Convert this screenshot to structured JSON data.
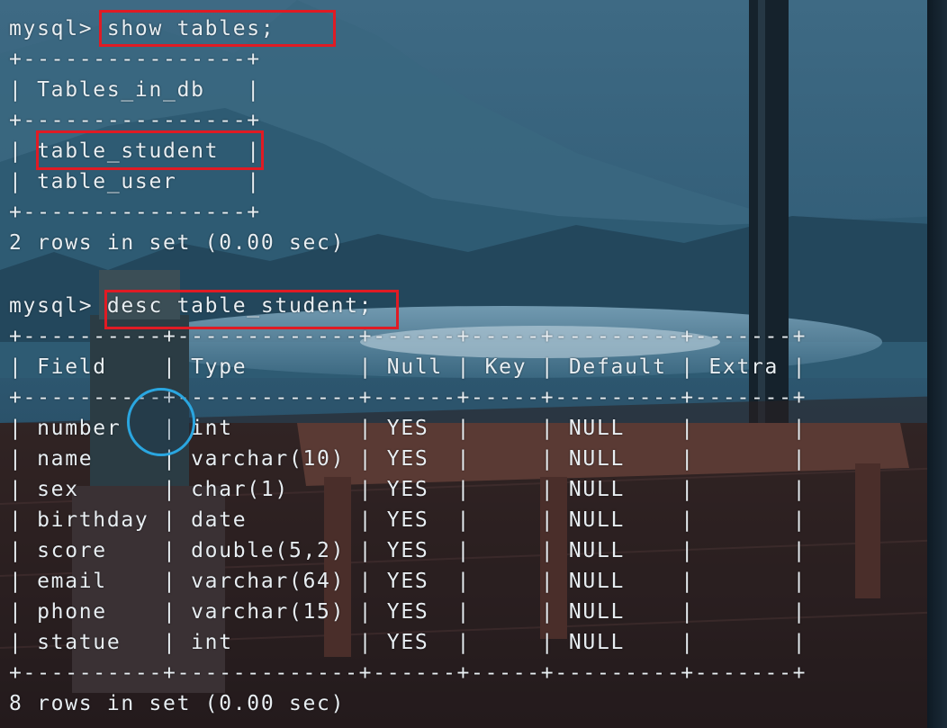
{
  "terminal": {
    "lines": [
      "mysql> show tables;",
      "+----------------+",
      "| Tables_in_db   |",
      "+----------------+",
      "| table_student  |",
      "| table_user     |",
      "+----------------+",
      "2 rows in set (0.00 sec)",
      "",
      "mysql> desc table_student;",
      "+----------+-------------+------+-----+---------+-------+",
      "| Field    | Type        | Null | Key | Default | Extra |",
      "+----------+-------------+------+-----+---------+-------+",
      "| number   | int         | YES  |     | NULL    |       |",
      "| name     | varchar(10) | YES  |     | NULL    |       |",
      "| sex      | char(1)     | YES  |     | NULL    |       |",
      "| birthday | date        | YES  |     | NULL    |       |",
      "| score    | double(5,2) | YES  |     | NULL    |       |",
      "| email    | varchar(64) | YES  |     | NULL    |       |",
      "| phone    | varchar(15) | YES  |     | NULL    |       |",
      "| statue   | int         | YES  |     | NULL    |       |",
      "+----------+-------------+------+-----+---------+-------+",
      "8 rows in set (0.00 sec)"
    ]
  },
  "colors": {
    "text": "#e8eef2",
    "highlight": "#e01b24",
    "cursor_ring": "#2aa6e0"
  }
}
